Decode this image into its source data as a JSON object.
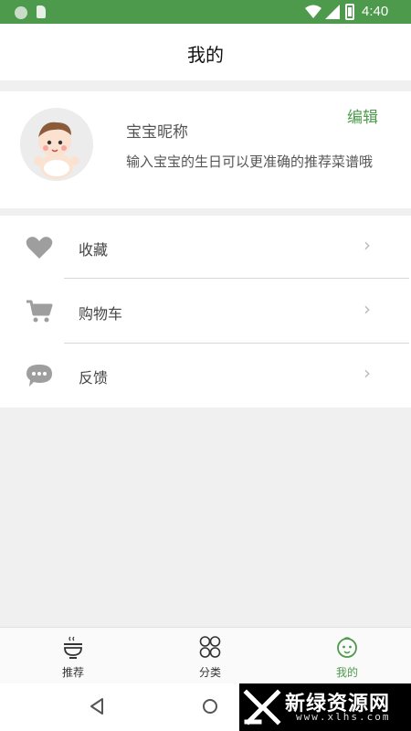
{
  "status_bar": {
    "time": "4:40"
  },
  "header": {
    "title": "我的"
  },
  "profile": {
    "nickname": "宝宝昵称",
    "edit_label": "编辑",
    "hint": "输入宝宝的生日可以更准确的推荐菜谱哦"
  },
  "menu": {
    "items": [
      {
        "label": "收藏",
        "icon": "heart-icon"
      },
      {
        "label": "购物车",
        "icon": "cart-icon"
      },
      {
        "label": "反馈",
        "icon": "chat-bubble-icon"
      }
    ],
    "chevron": "›"
  },
  "tabbar": {
    "tabs": [
      {
        "label": "推荐",
        "icon": "bowl-icon",
        "active": false
      },
      {
        "label": "分类",
        "icon": "grid-icon",
        "active": false
      },
      {
        "label": "我的",
        "icon": "baby-face-icon",
        "active": true
      }
    ]
  },
  "watermark": {
    "name": "新绿资源网",
    "url": "www.xlhs.com"
  },
  "colors": {
    "accent": "#4e9a4c",
    "background": "#f0f0f0",
    "icon_gray": "#9e9e9e"
  }
}
